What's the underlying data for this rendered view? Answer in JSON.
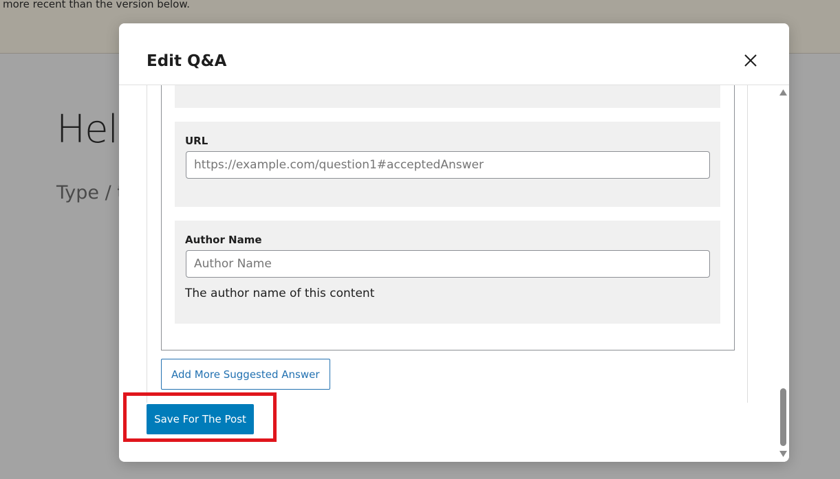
{
  "background": {
    "notice_text": "more recent than the version below.",
    "editor_title": "Hel",
    "editor_placeholder": "Type / t"
  },
  "modal": {
    "title": "Edit Q&A",
    "close_icon": "close-icon",
    "fields": [
      {
        "label": "URL",
        "placeholder": "https://example.com/question1#acceptedAnswer",
        "value": ""
      },
      {
        "label": "Author Name",
        "placeholder": "Author Name",
        "value": "",
        "help": "The author name of this content"
      }
    ],
    "add_more_label": "Add More Suggested Answer",
    "save_label": "Save For The Post"
  },
  "colors": {
    "accent": "#007cba",
    "outline_button": "#2271b1",
    "highlight": "#e0151c",
    "panel_bg": "#f0f0f0"
  }
}
